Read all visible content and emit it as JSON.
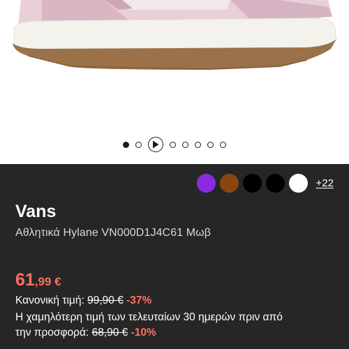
{
  "gallery": {
    "slide_count_before": 2,
    "slide_count_after": 5,
    "colors": {
      "dot": "#1c1c1c"
    }
  },
  "colors": {
    "panel_bg": "#262626",
    "accent_price": "#ff6f61",
    "swatches": [
      "#8a2be2",
      "#8b4513",
      "#000000",
      "#000000",
      "#ffffff"
    ]
  },
  "color_options": {
    "more_label": "+22"
  },
  "product": {
    "brand": "Vans",
    "name": "Αθλητικά Hylane VN000D1J4C61 Μωβ"
  },
  "pricing": {
    "price_int": "61",
    "price_dec": ",99 €",
    "regular_label": "Κανονική τιμή:",
    "regular_price": "99,90 €",
    "regular_discount": "-37%",
    "lowest_label_line1": "Η χαμηλότερη τιμή των τελευταίων 30 ημερών πριν από",
    "lowest_label_line2": "την προσφορά:",
    "lowest_price": "68,90 €",
    "lowest_discount": "-10%"
  }
}
